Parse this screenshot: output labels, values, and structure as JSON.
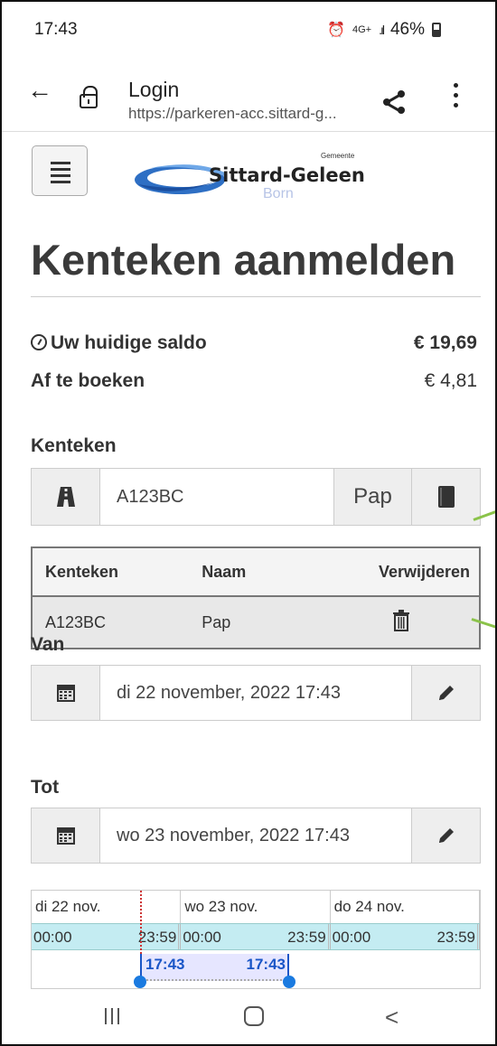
{
  "status_bar": {
    "time": "17:43",
    "network": "4G+",
    "battery": "46%"
  },
  "browser": {
    "title": "Login",
    "url": "https://parkeren-acc.sittard-g..."
  },
  "logo": {
    "gemeente": "Gemeente",
    "name": "Sittard-Geleen",
    "born": "Born"
  },
  "page": {
    "title": "Kenteken aanmelden"
  },
  "saldo": {
    "label": "Uw huidige saldo",
    "value": "€ 19,69"
  },
  "afboeken": {
    "label": "Af te boeken",
    "value": "€ 4,81"
  },
  "kenteken": {
    "label": "Kenteken",
    "value": "A123BC",
    "name_suffix": "Pap"
  },
  "table": {
    "headers": [
      "Kenteken",
      "Naam",
      "Verwijderen"
    ],
    "rows": [
      {
        "kenteken": "A123BC",
        "naam": "Pap"
      }
    ]
  },
  "van": {
    "label": "Van",
    "value": "di 22 november, 2022 17:43"
  },
  "tot": {
    "label": "Tot",
    "value": "wo 23 november, 2022 17:43"
  },
  "timeline": {
    "days": [
      "di 22 nov.",
      "wo 23 nov.",
      "do 24 nov."
    ],
    "hour_start": "00:00",
    "hour_end": "23:59",
    "selection_start": "17:43",
    "selection_end": "17:43"
  },
  "colors": {
    "accent": "#1a56c7",
    "timeline_hours": "#c4ecf2",
    "selection": "#e6e6ff"
  }
}
